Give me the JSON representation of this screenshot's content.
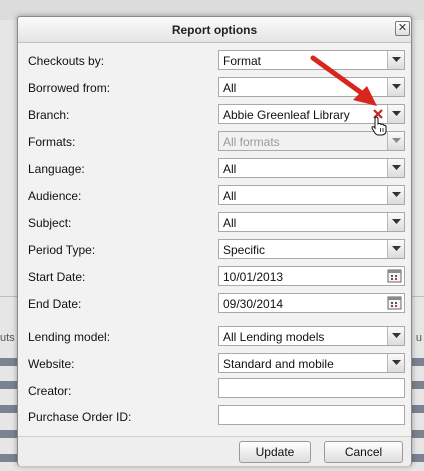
{
  "background": {
    "top_text": "",
    "left_label": "uts",
    "right_label": "u"
  },
  "dialog": {
    "title": "Report options",
    "close_glyph": "✕",
    "fields": [
      {
        "label": "Checkouts by:",
        "type": "select",
        "value": "Format"
      },
      {
        "label": "Borrowed from:",
        "type": "select",
        "value": "All"
      },
      {
        "label": "Branch:",
        "type": "select",
        "value": "Abbie Greenleaf Library",
        "clearable": true
      },
      {
        "label": "Formats:",
        "type": "select",
        "value": "All formats",
        "disabled": true
      },
      {
        "label": "Language:",
        "type": "select",
        "value": "All"
      },
      {
        "label": "Audience:",
        "type": "select",
        "value": "All"
      },
      {
        "label": "Subject:",
        "type": "select",
        "value": "All"
      },
      {
        "label": "Period Type:",
        "type": "select",
        "value": "Specific"
      },
      {
        "label": "Start Date:",
        "type": "date",
        "value": "10/01/2013"
      },
      {
        "label": "End Date:",
        "type": "date",
        "value": "09/30/2014"
      },
      {
        "label": "Lending model:",
        "type": "select",
        "value": "All Lending models"
      },
      {
        "label": "Website:",
        "type": "select",
        "value": "Standard and mobile"
      },
      {
        "label": "Creator:",
        "type": "text",
        "value": ""
      },
      {
        "label": "Purchase Order ID:",
        "type": "text",
        "value": ""
      }
    ],
    "buttons": {
      "update": "Update",
      "cancel": "Cancel"
    }
  },
  "colors": {
    "annotation_arrow": "#d9261c",
    "clear_x": "#c0291f",
    "dialog_bg": "#f2f2f2"
  },
  "icons": [
    "close-icon",
    "chevron-down-icon",
    "clear-icon",
    "calendar-icon",
    "annotation-arrow",
    "hand-cursor-icon"
  ]
}
